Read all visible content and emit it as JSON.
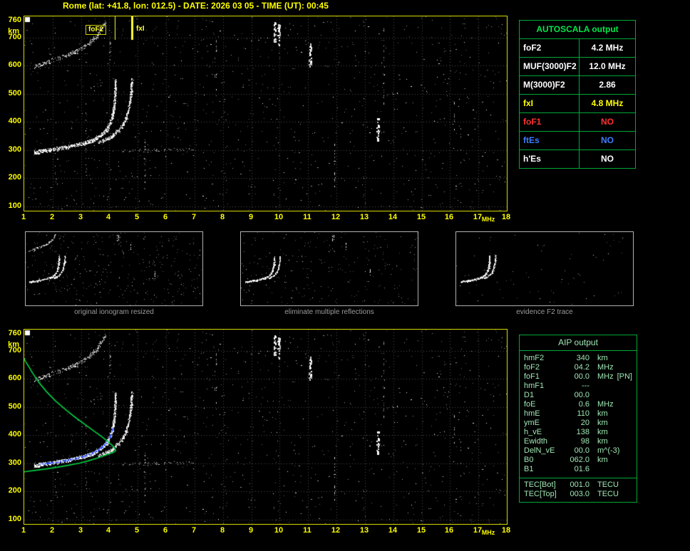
{
  "title": "Rome (lat: +41.8, lon: 012.5) - DATE: 2026 03 05 - TIME (UT): 00:45",
  "autoscala": {
    "header": "AUTOSCALA output",
    "rows": [
      {
        "label": "foF2",
        "value": "4.2 MHz"
      },
      {
        "label": "MUF(3000)F2",
        "value": "12.0 MHz"
      },
      {
        "label": "M(3000)F2",
        "value": "2.86"
      },
      {
        "label": "fxI",
        "value": "4.8 MHz"
      },
      {
        "label": "foF1",
        "value": "NO"
      },
      {
        "label": "ftEs",
        "value": "NO"
      },
      {
        "label": "h'Es",
        "value": "NO"
      }
    ]
  },
  "aip": {
    "header": "AIP output",
    "rows": [
      {
        "label": "hmF2",
        "value": "340",
        "unit": "km"
      },
      {
        "label": "foF2",
        "value": "04.2",
        "unit": "MHz"
      },
      {
        "label": "foF1",
        "value": "00.0",
        "unit": "MHz",
        "note": "[PN]"
      },
      {
        "label": "hmF1",
        "value": "---",
        "unit": ""
      },
      {
        "label": "D1",
        "value": "00.0",
        "unit": ""
      },
      {
        "label": "foE",
        "value": "0.6",
        "unit": "MHz"
      },
      {
        "label": "hmE",
        "value": "110",
        "unit": "km"
      },
      {
        "label": "ymE",
        "value": "20",
        "unit": "km"
      },
      {
        "label": "h_vE",
        "value": "138",
        "unit": "km"
      },
      {
        "label": "Ewidth",
        "value": "98",
        "unit": "km"
      },
      {
        "label": "DelN_vE",
        "value": "00.0",
        "unit": "m^(-3)"
      },
      {
        "label": "B0",
        "value": "062.0",
        "unit": "km"
      },
      {
        "label": "B1",
        "value": "01.6",
        "unit": ""
      }
    ],
    "tec_rows": [
      {
        "label": "TEC[Bot]",
        "value": "001.0",
        "unit": "TECU"
      },
      {
        "label": "TEC[Top]",
        "value": "003.0",
        "unit": "TECU"
      }
    ]
  },
  "thumbnails": [
    {
      "caption": "original ionogram resized"
    },
    {
      "caption": "eliminate multiple reflections"
    },
    {
      "caption": "evidence F2 trace"
    }
  ],
  "colors": {
    "background": "#000000",
    "axis_yellow": "#ffff00",
    "plot_border": "#d8d800",
    "grid": "#4f4f4f",
    "table_green": "#00a838",
    "header_green": "#00e84c",
    "aip_text": "#9fe7b4",
    "caption_gray": "#9a9a9a",
    "marker": "#ffff30",
    "profile": "#00cc44",
    "restored_trace": "#2c50ff",
    "value_white": "#ffffff",
    "fxi_yellow": "#ffff00",
    "fof1_red": "#ff3030",
    "ftes_blue": "#3d7dff"
  },
  "chart_data": {
    "type": "scatter",
    "description": "Ionogram: virtual height (km) vs sounding frequency (MHz); top = autoscaled ionogram, bottom = same ionogram with restored F2 trace (blue) and electron density profile (green)",
    "axes": {
      "x_unit": "MHz",
      "y_unit": "km",
      "x_range": [
        1,
        18
      ],
      "y_range": [
        100,
        760
      ],
      "x_ticks": [
        1,
        2,
        3,
        4,
        5,
        6,
        7,
        8,
        9,
        10,
        11,
        12,
        13,
        14,
        15,
        16,
        17,
        18
      ],
      "y_ticks": [
        760,
        700,
        600,
        500,
        400,
        300,
        200,
        100
      ]
    },
    "markers": [
      {
        "label": "foF2",
        "f": 4.2
      },
      {
        "label": "fxI",
        "f": 4.8
      }
    ],
    "scaled_values": {
      "foF2_MHz": 4.2,
      "MUF3000F2_MHz": 12.0,
      "M3000F2": 2.86,
      "fxI_MHz": 4.8,
      "hmF2_km": 340
    },
    "traces": {
      "f2_ordinary": [
        [
          1.35,
          292
        ],
        [
          1.7,
          298
        ],
        [
          2.1,
          304
        ],
        [
          2.5,
          311
        ],
        [
          2.9,
          319
        ],
        [
          3.2,
          327
        ],
        [
          3.45,
          337
        ],
        [
          3.65,
          349
        ],
        [
          3.82,
          363
        ],
        [
          3.95,
          380
        ],
        [
          4.05,
          401
        ],
        [
          4.12,
          427
        ],
        [
          4.17,
          457
        ],
        [
          4.2,
          490
        ],
        [
          4.22,
          525
        ],
        [
          4.23,
          550
        ]
      ],
      "f2_extraordinary": [
        [
          3.6,
          328
        ],
        [
          3.85,
          336
        ],
        [
          4.05,
          346
        ],
        [
          4.22,
          358
        ],
        [
          4.37,
          373
        ],
        [
          4.49,
          391
        ],
        [
          4.59,
          413
        ],
        [
          4.66,
          439
        ],
        [
          4.72,
          469
        ],
        [
          4.76,
          500
        ],
        [
          4.79,
          530
        ],
        [
          4.8,
          552
        ]
      ],
      "second_hop": [
        [
          1.35,
          597
        ],
        [
          1.7,
          609
        ],
        [
          2.05,
          621
        ],
        [
          2.4,
          633
        ],
        [
          2.7,
          645
        ],
        [
          3.0,
          659
        ],
        [
          3.25,
          675
        ],
        [
          3.45,
          693
        ],
        [
          3.62,
          713
        ],
        [
          3.76,
          735
        ],
        [
          3.87,
          757
        ]
      ],
      "spread_echo": [
        [
          4.4,
          297
        ],
        [
          5.3,
          299
        ],
        [
          6.3,
          301
        ],
        [
          7.2,
          303
        ]
      ]
    },
    "overlays": {
      "profile_green": [
        [
          1.0,
          270
        ],
        [
          1.35,
          275
        ],
        [
          1.75,
          280
        ],
        [
          2.15,
          286
        ],
        [
          2.55,
          293
        ],
        [
          2.95,
          301
        ],
        [
          3.25,
          309
        ],
        [
          3.55,
          318
        ],
        [
          3.8,
          327
        ],
        [
          4.0,
          334
        ],
        [
          4.15,
          340
        ],
        [
          4.22,
          345
        ],
        [
          4.2,
          352
        ],
        [
          4.1,
          364
        ],
        [
          3.94,
          378
        ],
        [
          3.73,
          395
        ],
        [
          3.47,
          414
        ],
        [
          3.17,
          436
        ],
        [
          2.83,
          461
        ],
        [
          2.48,
          489
        ],
        [
          2.12,
          520
        ],
        [
          1.8,
          553
        ],
        [
          1.52,
          587
        ],
        [
          1.3,
          620
        ],
        [
          1.14,
          647
        ],
        [
          1.04,
          663
        ],
        [
          1.0,
          671
        ]
      ],
      "restored_trace_blue": [
        [
          1.55,
          296
        ],
        [
          1.9,
          301
        ],
        [
          2.3,
          307
        ],
        [
          2.7,
          314
        ],
        [
          3.05,
          323
        ],
        [
          3.35,
          333
        ],
        [
          3.6,
          346
        ],
        [
          3.8,
          361
        ],
        [
          3.95,
          379
        ],
        [
          4.06,
          400
        ],
        [
          4.13,
          423
        ]
      ]
    },
    "interference": [
      {
        "f": 9.82,
        "km": [
          686,
          757
        ]
      },
      {
        "f": 9.97,
        "km": [
          670,
          750
        ]
      },
      {
        "f": 11.08,
        "km": [
          598,
          678
        ]
      },
      {
        "f": 13.45,
        "km": [
          326,
          418
        ]
      }
    ],
    "noise": {
      "main_count": 980,
      "seed_main": 11,
      "thumbs": [
        {
          "count": 360,
          "seed": 3,
          "second_hop": true
        },
        {
          "count": 250,
          "seed": 5,
          "second_hop": false
        },
        {
          "count": 70,
          "seed": 9,
          "second_hop": false
        }
      ]
    }
  }
}
